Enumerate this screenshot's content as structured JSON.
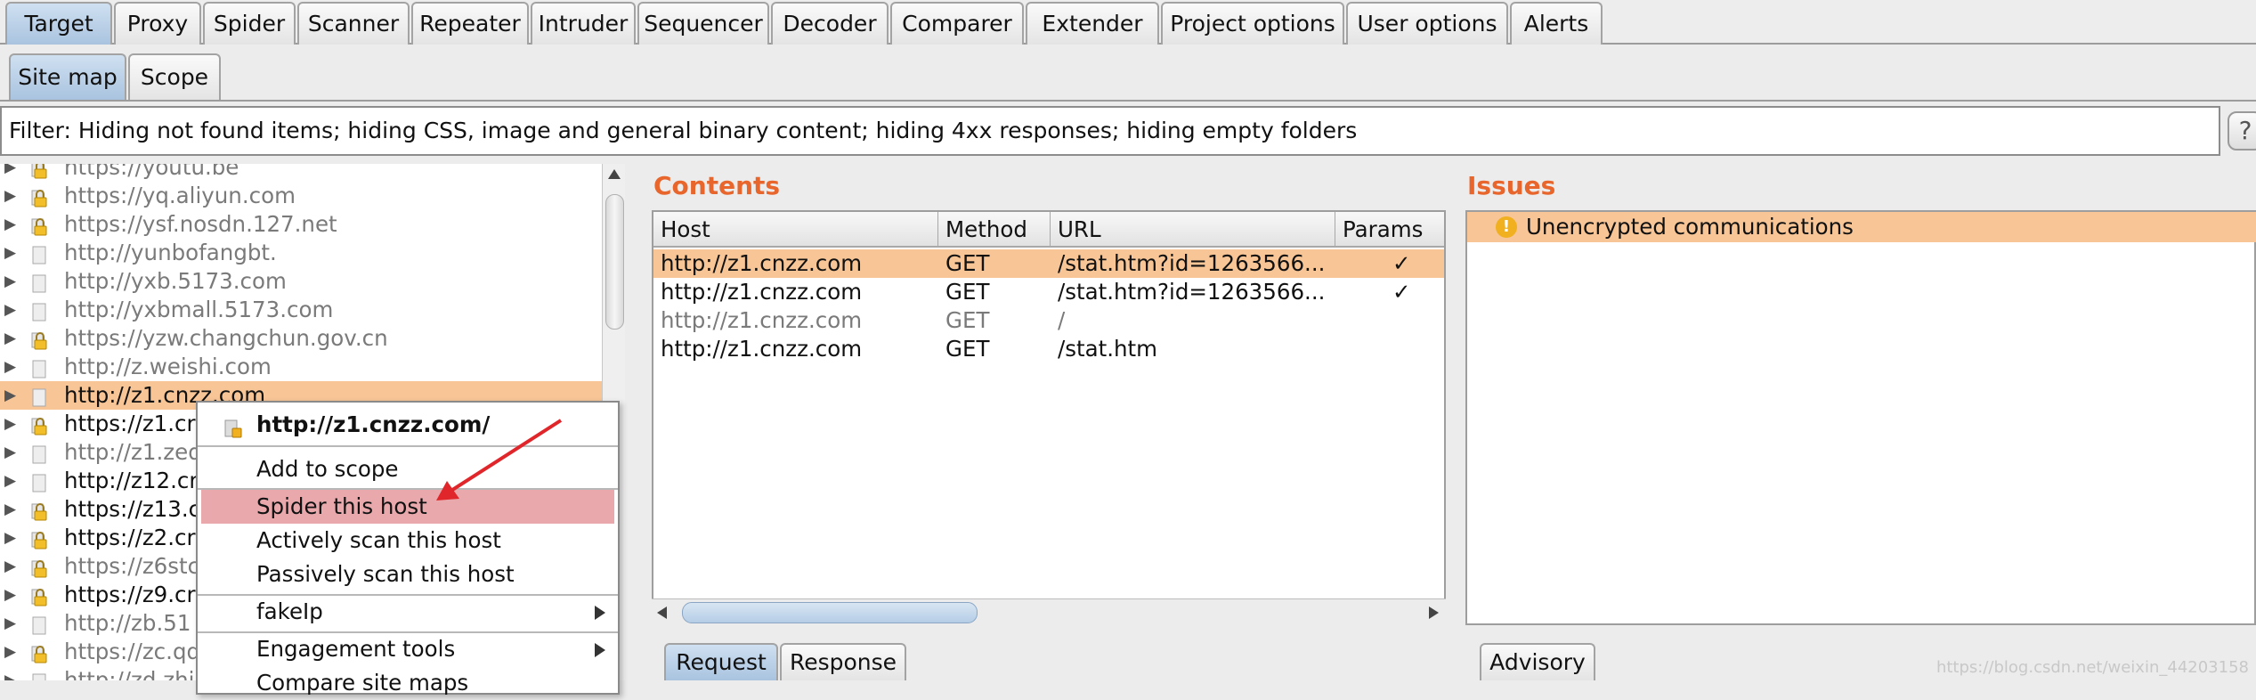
{
  "top_tabs": [
    "Target",
    "Proxy",
    "Spider",
    "Scanner",
    "Repeater",
    "Intruder",
    "Sequencer",
    "Decoder",
    "Comparer",
    "Extender",
    "Project options",
    "User options",
    "Alerts"
  ],
  "sub_tabs": [
    "Site map",
    "Scope"
  ],
  "filter_text": "Filter: Hiding not found items;  hiding CSS, image and general binary content;  hiding 4xx responses;  hiding empty folders",
  "help_label": "?",
  "site_tree": [
    {
      "label": "https://youtu.be",
      "lock": true,
      "grey": true
    },
    {
      "label": "https://yq.aliyun.com",
      "lock": true,
      "grey": true
    },
    {
      "label": "https://ysf.nosdn.127.net",
      "lock": true,
      "grey": true
    },
    {
      "label": "http://yunbofangbt.",
      "lock": false,
      "grey": true
    },
    {
      "label": "http://yxb.5173.com",
      "lock": false,
      "grey": true
    },
    {
      "label": "http://yxbmall.5173.com",
      "lock": false,
      "grey": true
    },
    {
      "label": "https://yzw.changchun.gov.cn",
      "lock": true,
      "grey": true
    },
    {
      "label": "http://z.weishi.com",
      "lock": false,
      "grey": true
    },
    {
      "label": "http://z1.cnzz.com",
      "lock": false,
      "grey": false,
      "selected": true
    },
    {
      "label": "https://z1.cr",
      "lock": true,
      "grey": false
    },
    {
      "label": "http://z1.zed",
      "lock": false,
      "grey": true
    },
    {
      "label": "http://z12.cr",
      "lock": false,
      "grey": false
    },
    {
      "label": "https://z13.c",
      "lock": true,
      "grey": false
    },
    {
      "label": "https://z2.cr",
      "lock": true,
      "grey": false
    },
    {
      "label": "https://z6stc",
      "lock": true,
      "grey": true
    },
    {
      "label": "https://z9.cr",
      "lock": true,
      "grey": false
    },
    {
      "label": "http://zb.51",
      "lock": false,
      "grey": true
    },
    {
      "label": "https://zc.qq",
      "lock": true,
      "grey": true
    },
    {
      "label": "http://zd.zhi",
      "lock": false,
      "grey": true
    }
  ],
  "contents": {
    "title": "Contents",
    "columns": [
      "Host",
      "Method",
      "URL",
      "Params"
    ],
    "rows": [
      {
        "host": "http://z1.cnzz.com",
        "method": "GET",
        "url": "/stat.htm?id=1263566...",
        "params": "✓",
        "selected": true,
        "grey": false
      },
      {
        "host": "http://z1.cnzz.com",
        "method": "GET",
        "url": "/stat.htm?id=1263566...",
        "params": "✓",
        "selected": false,
        "grey": false
      },
      {
        "host": "http://z1.cnzz.com",
        "method": "GET",
        "url": "/",
        "params": "",
        "selected": false,
        "grey": true
      },
      {
        "host": "http://z1.cnzz.com",
        "method": "GET",
        "url": "/stat.htm",
        "params": "",
        "selected": false,
        "grey": false
      }
    ]
  },
  "issues": {
    "title": "Issues",
    "items": [
      "Unencrypted communications"
    ]
  },
  "bottom_tabs": {
    "request": "Request",
    "response": "Response",
    "advisory": "Advisory"
  },
  "context_menu": {
    "header": "http://z1.cnzz.com/",
    "items": [
      {
        "label": "Add to scope",
        "submenu": false
      },
      {
        "label": "Spider this host",
        "submenu": false,
        "highlighted": true
      },
      {
        "label": "Actively scan this host",
        "submenu": false
      },
      {
        "label": "Passively scan this host",
        "submenu": false
      },
      {
        "label": "fakeIp",
        "submenu": true
      },
      {
        "label": "Engagement tools",
        "submenu": true
      },
      {
        "label": "Compare site maps",
        "submenu": false
      }
    ]
  },
  "watermark": "https://blog.csdn.net/weixin_44203158",
  "colors": {
    "accent_orange": "#e8652c",
    "selection": "#f7c596",
    "menu_highlight": "#e8a8ac",
    "arrow_red": "#e0262a"
  }
}
